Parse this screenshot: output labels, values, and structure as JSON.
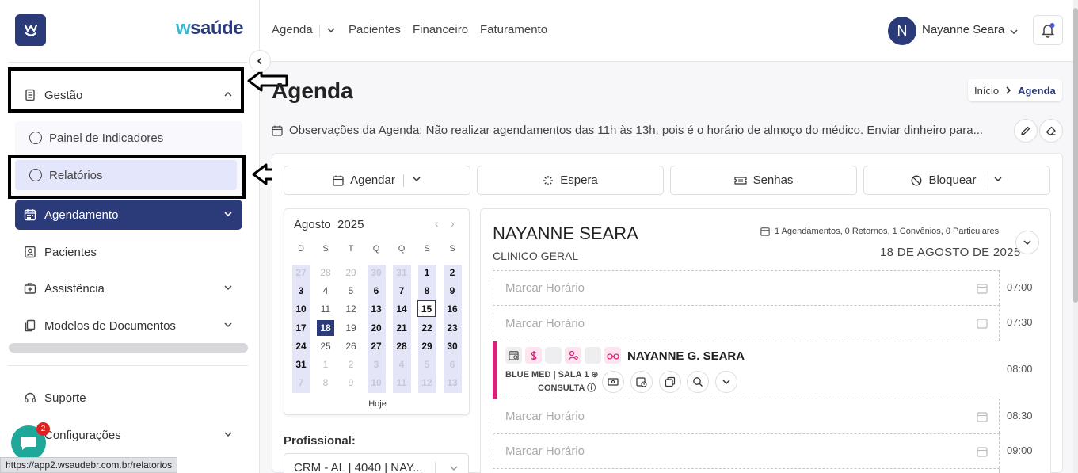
{
  "brand": {
    "logo_text_w": "w",
    "logo_text_rest": "saúde"
  },
  "sidebar": {
    "gestao": "Gestão",
    "submenu": [
      "Painel de Indicadores",
      "Relatórios"
    ],
    "items": [
      {
        "label": "Agendamento"
      },
      {
        "label": "Pacientes"
      },
      {
        "label": "Assistência"
      },
      {
        "label": "Modelos de Documentos"
      }
    ],
    "bottom": [
      {
        "label": "Suporte"
      },
      {
        "label": "Configurações"
      }
    ],
    "chat_badge": "2"
  },
  "status_url": "https://app2.wsaudebr.com.br/relatorios",
  "topnav": {
    "agenda": "Agenda",
    "pacientes": "Pacientes",
    "financeiro": "Financeiro",
    "faturamento": "Faturamento"
  },
  "user": {
    "initial": "N",
    "name": "Nayanne Seara"
  },
  "page": {
    "title": "Agenda",
    "breadcrumb": {
      "home": "Início",
      "current": "Agenda"
    },
    "observacoes": "Observações da Agenda: Não realizar agendamentos das 11h às 13h, pois é o horário de almoço do médico. Enviar dinheiro para..."
  },
  "actions": {
    "agendar": "Agendar",
    "espera": "Espera",
    "senhas": "Senhas",
    "bloquear": "Bloquear"
  },
  "calendar": {
    "month": "Agosto",
    "year": "2025",
    "weekdays": [
      "D",
      "S",
      "T",
      "Q",
      "Q",
      "S",
      "S"
    ],
    "weeks": [
      [
        "27",
        "28",
        "29",
        "30",
        "31",
        "1",
        "2"
      ],
      [
        "3",
        "4",
        "5",
        "6",
        "7",
        "8",
        "9"
      ],
      [
        "10",
        "11",
        "12",
        "13",
        "14",
        "15",
        "16"
      ],
      [
        "17",
        "18",
        "19",
        "20",
        "21",
        "22",
        "23"
      ],
      [
        "24",
        "25",
        "26",
        "27",
        "28",
        "29",
        "30"
      ],
      [
        "31",
        "1",
        "2",
        "3",
        "4",
        "5",
        "6"
      ],
      [
        "7",
        "8",
        "9",
        "10",
        "11",
        "12",
        "13"
      ]
    ],
    "today": "18",
    "selected": "15",
    "hoje": "Hoje"
  },
  "profissional": {
    "label": "Profissional:",
    "value": "CRM - AL | 4040 | NAY..."
  },
  "schedule": {
    "doctor": "NAYANNE SEARA",
    "specialty": "CLINICO GERAL",
    "summary": [
      "1 Agendamentos, 0 Retornos,",
      "1 Convênios, 0 Particulares"
    ],
    "date": "18 DE AGOSTO DE 2025",
    "slot_placeholder": "Marcar Horário",
    "times": [
      "07:00",
      "07:30",
      "08:00",
      "08:30",
      "09:00"
    ],
    "appointment": {
      "patient": "NAYANNE G. SEARA",
      "line1": "BLUE MED | SALA 1",
      "line2": "CONSULTA"
    }
  }
}
